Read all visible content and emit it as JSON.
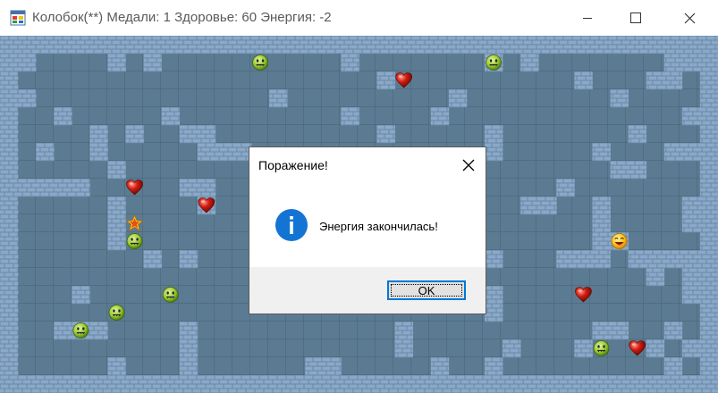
{
  "window": {
    "title": "Колобок(**) Медали: 1 Здоровье: 60 Энергия: -2",
    "app_icon": "windows-forms-app-icon",
    "controls": [
      "minimize-icon",
      "maximize-icon",
      "close-icon"
    ]
  },
  "board": {
    "cols": 40,
    "rows": 20,
    "colors": {
      "floor": "#5b7b92",
      "grid": "#4a6679",
      "brick": "#8aa8c8",
      "mortar": "#6a88a6"
    },
    "wall_map": [
      "WWWWWWWWWWWWWWWWWWWWWWWWWWWWWWWWWWWWWWWW",
      "WW....W.W..........W.......W.W.......WWW",
      "W....................W..........W...WW.W",
      "WW.............W.........W........W....W",
      "W..W.....W.........W....W.............WW",
      "W....W.W..WW.........W.....W.......W...W",
      "W.W..W.....WWW.............W.....W...WWW",
      "W.....W.............W.............WW...W",
      "WWWWW.....WW...................W.......W",
      "W.....W....W.................WW..W....WW",
      "W.....W..........................W....WW",
      "W.....W..........................WW....W",
      "W.......W.W................W...WWW.WWWWW",
      "W..................W.....W..........W.WW",
      "W...W...................W..W..........WW",
      "W..........................W...........W",
      "W..WWW....W...........W..........WW..W.W",
      "W.........W...........W.....W...W...W.WW",
      "W.....W...W......WW.....W..W.........W.W",
      "WWWWWWWWWWWWWWWWWWWWWWWWWWWWWWWWWWWWWWWW"
    ],
    "entities": [
      {
        "type": "enemy",
        "name": "green-enemy-smiley",
        "col": 14,
        "row": 1
      },
      {
        "type": "enemy",
        "name": "green-enemy-smiley",
        "col": 27,
        "row": 1
      },
      {
        "type": "heart",
        "name": "heart",
        "col": 22,
        "row": 2
      },
      {
        "type": "heart",
        "name": "heart",
        "col": 7,
        "row": 8
      },
      {
        "type": "heart",
        "name": "heart",
        "col": 11,
        "row": 9
      },
      {
        "type": "medal",
        "name": "star-medal",
        "col": 7,
        "row": 10
      },
      {
        "type": "enemy",
        "name": "green-enemy-smiley",
        "col": 7,
        "row": 11
      },
      {
        "type": "player",
        "name": "kolobok-player",
        "col": 34,
        "row": 11
      },
      {
        "type": "enemy",
        "name": "green-enemy-smiley",
        "col": 9,
        "row": 14
      },
      {
        "type": "heart",
        "name": "heart",
        "col": 32,
        "row": 14
      },
      {
        "type": "enemy",
        "name": "green-enemy-smiley",
        "col": 6,
        "row": 15
      },
      {
        "type": "enemy",
        "name": "green-enemy-smiley",
        "col": 4,
        "row": 16
      },
      {
        "type": "enemy",
        "name": "green-enemy-smiley",
        "col": 33,
        "row": 17
      },
      {
        "type": "heart",
        "name": "heart",
        "col": 35,
        "row": 17
      }
    ]
  },
  "dialog": {
    "title": "Поражение!",
    "message": "Энергия закончилась!",
    "icon": "info-icon",
    "ok_label": "OK"
  }
}
